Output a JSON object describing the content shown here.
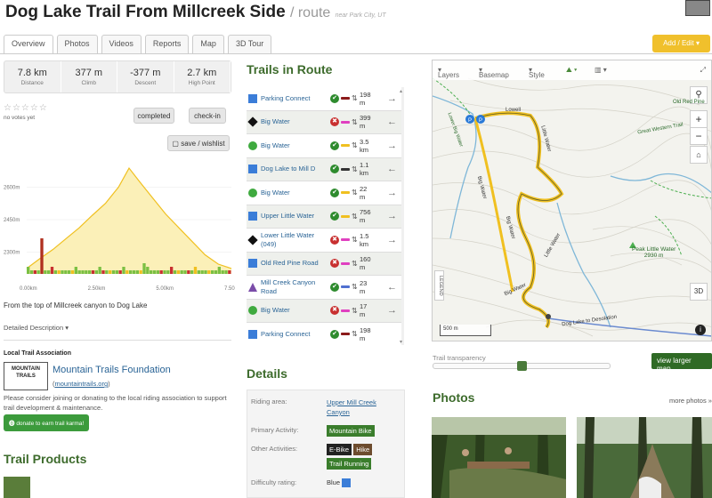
{
  "header": {
    "title": "Dog Lake Trail From Millcreek Side",
    "subtitle": "/ route",
    "location": "near Park City, UT"
  },
  "tabs": [
    "Overview",
    "Photos",
    "Videos",
    "Reports",
    "Map",
    "3D Tour"
  ],
  "add_edit": "Add / Edit",
  "stats": [
    {
      "value": "7.8 km",
      "label": "Distance"
    },
    {
      "value": "377 m",
      "label": "Climb"
    },
    {
      "value": "-377 m",
      "label": "Descent"
    },
    {
      "value": "2.7 km",
      "label": "High Point"
    }
  ],
  "rating": {
    "stars": "☆☆☆☆☆",
    "votes": "no votes yet"
  },
  "buttons": {
    "completed": "completed",
    "checkin": "check-in",
    "save": "save / wishlist"
  },
  "chart_data": {
    "type": "area",
    "xlabel": "",
    "ylabel": "",
    "x": [
      0,
      0.5,
      1,
      1.5,
      2,
      2.5,
      3,
      3.5,
      3.9,
      4.3,
      4.8,
      5.3,
      5.8,
      6.3,
      6.8,
      7.3,
      7.8
    ],
    "y": [
      2300,
      2318,
      2335,
      2355,
      2375,
      2398,
      2420,
      2450,
      2485,
      2460,
      2430,
      2400,
      2375,
      2350,
      2325,
      2308,
      2300
    ],
    "yticks": [
      "2600m",
      "2450m",
      "2300m"
    ],
    "xticks": [
      "0.00km",
      "2.50km",
      "5.00km",
      "7.50km"
    ],
    "ylim": [
      2290,
      2490
    ],
    "xlim": [
      0,
      7.8
    ]
  },
  "description": "From the top of Millcreek canyon to Dog Lake",
  "detailed_desc": "Detailed Description",
  "assoc": {
    "heading": "Local Trail Association",
    "logo_text": "MOUNTAIN TRAILS",
    "name": "Mountain Trails Foundation",
    "url": "mountaintrails.org",
    "note": "Please consider joining or donating to the local riding association to support trail development & maintenance.",
    "donate": "donate to earn trail karma!"
  },
  "products_heading": "Trail Products",
  "trails_heading": "Trails in Route",
  "trails": [
    {
      "name": "Parking Connect",
      "icon": "blue-square",
      "diff": "green",
      "line": "#8b1a1a",
      "len": "198 m",
      "dir": "→"
    },
    {
      "name": "Big Water",
      "icon": "black-diamond",
      "diff": "red",
      "line": "#e040c0",
      "len": "399 m",
      "dir": "←"
    },
    {
      "name": "Big Water",
      "icon": "green-circle",
      "diff": "green",
      "line": "#f0c020",
      "len": "3.5 km",
      "dir": "→"
    },
    {
      "name": "Dog Lake to Mill D",
      "icon": "blue-square",
      "diff": "green",
      "line": "#333",
      "len": "1.1 km",
      "dir": "←"
    },
    {
      "name": "Big Water",
      "icon": "green-circle",
      "diff": "green",
      "line": "#f0c020",
      "len": "22 m",
      "dir": "→"
    },
    {
      "name": "Upper Little Water",
      "icon": "blue-square",
      "diff": "green",
      "line": "#f0c020",
      "len": "756 m",
      "dir": "→"
    },
    {
      "name": "Lower Little Water (049)",
      "icon": "black-diamond",
      "diff": "red",
      "line": "#e040c0",
      "len": "1.5 km",
      "dir": "→"
    },
    {
      "name": "Old Red Pine Road",
      "icon": "blue-square",
      "diff": "red",
      "line": "#e040c0",
      "len": "160 m",
      "dir": ""
    },
    {
      "name": "Mill Creek Canyon Road",
      "icon": "purple-triangle",
      "diff": "green",
      "line": "#5070d0",
      "len": "23 m",
      "dir": "←"
    },
    {
      "name": "Big Water",
      "icon": "green-circle",
      "diff": "red",
      "line": "#e040c0",
      "len": "17 m",
      "dir": "→"
    },
    {
      "name": "Parking Connect",
      "icon": "blue-square",
      "diff": "green",
      "line": "#8b1a1a",
      "len": "198 m",
      "dir": ""
    }
  ],
  "details": {
    "heading": "Details",
    "riding_area_label": "Riding area:",
    "riding_area": "Upper Mill Creek Canyon",
    "primary_label": "Primary Activity:",
    "primary": "Mountain Bike",
    "other_label": "Other Activities:",
    "other": [
      "E-Bike",
      "Hike",
      "Trail Running"
    ],
    "difficulty_label": "Difficulty rating:",
    "difficulty": "Blue"
  },
  "map": {
    "layers": "Layers",
    "basemap": "Basemap",
    "style": "Style",
    "labels": [
      "Old Red Pine",
      "Lower Big Water",
      "Big Water",
      "Little Water",
      "Peak Little Water",
      "2930 m",
      "Dog Lake to Desolation",
      "Great Western Trail",
      "Big Water",
      "Lowell",
      "Big Water",
      "Little Water"
    ],
    "scale": "500 m",
    "legend": "LEGEND",
    "btn3d": "3D"
  },
  "transparency_label": "Trail transparency",
  "view_larger": "view larger map",
  "photos_heading": "Photos",
  "more_photos": "more photos »"
}
